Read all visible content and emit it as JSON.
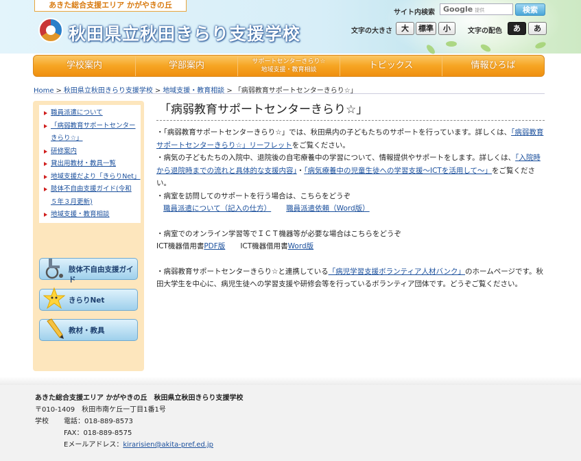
{
  "header": {
    "tagline": "あきた総合支援エリア かがやきの丘",
    "school_name": "秋田県立秋田きらり支援学校",
    "search_label": "サイト内検索",
    "search_placeholder_brand": "Google",
    "search_placeholder_sub": "提供",
    "search_button": "検索",
    "text_size_label": "文字の大きさ",
    "text_size_large": "大",
    "text_size_normal": "標準",
    "text_size_small": "小",
    "color_label": "文字の配色",
    "color_dark": "あ",
    "color_light": "あ"
  },
  "nav": {
    "items": [
      "学校案内",
      "学部案内",
      "サポートセンターきらり☆",
      "地域支援・教育相談",
      "トピックス",
      "情報ひろば"
    ]
  },
  "breadcrumb": {
    "items": [
      "Home",
      "秋田県立秋田きらり支援学校",
      "地域支援・教育相談",
      "「病弱教育サポートセンターきらり☆」"
    ],
    "separator": ">"
  },
  "sidebar": {
    "items": [
      "職員派遣について",
      "「病弱教育サポートセンターきらり☆」",
      "研修案内",
      "貸出用教材・教具一覧",
      "地域支援だより「きらりNet」",
      "肢体不自由支援ガイド(令和５年３月更新)",
      "地域支援・教育相談"
    ],
    "banners": [
      "肢体不自由支援ガイド",
      "きらりNet",
      "教材・教具"
    ]
  },
  "main": {
    "title": "「病弱教育サポートセンターきらり☆」",
    "p1_text": "・「病弱教育サポートセンターきらり☆」では、秋田県内の子どもたちのサポートを行っています。詳しくは、",
    "p1_link": "「病弱教育サポートセンターきらり☆」リーフレット",
    "p1_tail": "をご覧ください。",
    "p2_text": "・病気の子どもたちの入院中、退院後の自宅療養中の学習について、情報提供やサポートをします。詳しくは、",
    "p2_link1": "「入院時から退院時までの流れと具体的な支援内容」",
    "p2_mid": "・",
    "p2_link2": "「病気療養中の児童生徒への学習支援～ICTを活用して～」",
    "p2_tail": "をご覧ください。",
    "p3_text": "・病室を訪問してのサポートを行う場合は、こちらをどうぞ",
    "p3_link1": "職員派遣について（記入の仕方）",
    "p3_link2": "職員派遣依頼（Word版）",
    "p4_text": "・病室でのオンライン学習等でＩＣＴ機器等が必要な場合はこちらをどうぞ",
    "p4_label1": "ICT機器借用書",
    "p4_link1": "PDF版",
    "p4_label2": "ICT機器借用書",
    "p4_link2": "Word版",
    "p5_text": "・病弱教育サポートセンターきらり☆と連携している",
    "p5_link": "「病児学習支援ボランティア人材バンク」",
    "p5_tail": "のホームページです。秋田大学生を中心に、病児生徒への学習支援や研修会等を行っているボランティア団体です。どうぞご覧ください。"
  },
  "footer": {
    "title": "あきた総合支援エリア かがやきの丘　秋田県立秋田きらり支援学校",
    "address": "〒010-1409　秋田市南ケ丘一丁目1番1号",
    "school_label": "学校",
    "tel": "電話：018-889-8573",
    "fax": "FAX：018-889-8575",
    "email_label": "Eメールアドレス：",
    "email": "kirarisien@akita-pref.ed.jp"
  },
  "colors": {
    "nav_orange": "#f6a523",
    "sidebar_bg": "#fde6bd",
    "link": "#1a4f9c",
    "bullet_red": "#d0201f"
  }
}
